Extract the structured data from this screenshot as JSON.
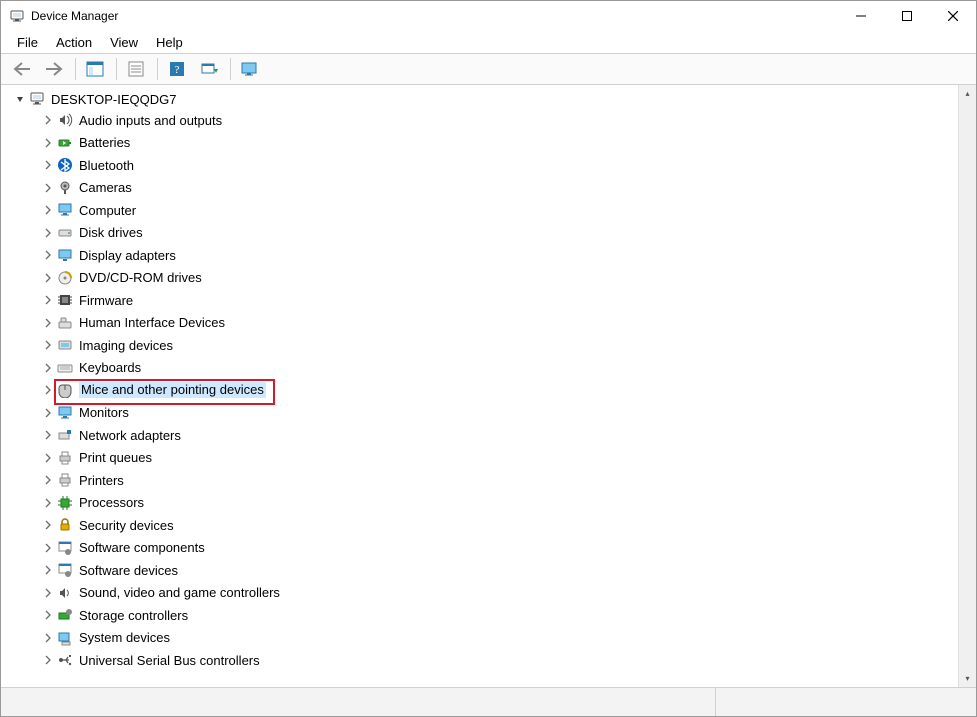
{
  "window": {
    "title": "Device Manager"
  },
  "menu": {
    "file": "File",
    "action": "Action",
    "view": "View",
    "help": "Help"
  },
  "toolbar": {
    "back": "Back",
    "forward": "Forward",
    "showhide": "Show/Hide Console Tree",
    "properties": "Properties",
    "help": "Help",
    "scan": "Scan for hardware changes",
    "monitor": "Add legacy hardware"
  },
  "tree": {
    "root": "DESKTOP-IEQQDG7",
    "items": [
      "Audio inputs and outputs",
      "Batteries",
      "Bluetooth",
      "Cameras",
      "Computer",
      "Disk drives",
      "Display adapters",
      "DVD/CD-ROM drives",
      "Firmware",
      "Human Interface Devices",
      "Imaging devices",
      "Keyboards",
      "Mice and other pointing devices",
      "Monitors",
      "Network adapters",
      "Print queues",
      "Printers",
      "Processors",
      "Security devices",
      "Software components",
      "Software devices",
      "Sound, video and game controllers",
      "Storage controllers",
      "System devices",
      "Universal Serial Bus controllers"
    ],
    "highlighted_index": 12
  }
}
